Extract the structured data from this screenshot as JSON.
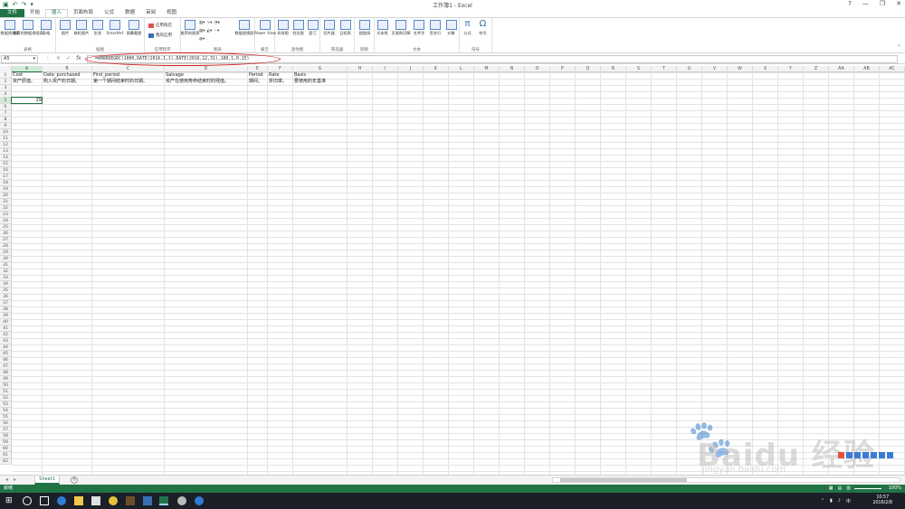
{
  "window": {
    "title": "工作簿1 - Excel",
    "controls": [
      "?",
      "—",
      "❐",
      "✕"
    ]
  },
  "qat": {
    "save_icon": "save-icon",
    "undo_icon": "undo-icon",
    "redo_icon": "redo-icon"
  },
  "tabs": [
    "文件",
    "开始",
    "插入",
    "页面布局",
    "公式",
    "数据",
    "审阅",
    "视图"
  ],
  "ribbon": {
    "groups": [
      {
        "name": "表格",
        "buttons": [
          "数据透视表",
          "推荐的数据透视表",
          "表格"
        ]
      },
      {
        "name": "插图",
        "buttons": [
          "图片",
          "联机图片",
          "形状",
          "SmartArt",
          "屏幕截图"
        ]
      },
      {
        "name": "应用程序",
        "buttons": [
          "应用商店",
          "我的应用"
        ]
      },
      {
        "name": "图表",
        "buttons": [
          "推荐的图表",
          "数据透视图"
        ]
      },
      {
        "name": "报告",
        "buttons": [
          "Power View"
        ]
      },
      {
        "name": "迷你图",
        "buttons": [
          "折线图",
          "柱形图",
          "盈亏"
        ]
      },
      {
        "name": "筛选器",
        "buttons": [
          "切片器",
          "日程表"
        ]
      },
      {
        "name": "链接",
        "buttons": [
          "超链接"
        ]
      },
      {
        "name": "文本",
        "buttons": [
          "文本框",
          "页眉和页脚",
          "艺术字",
          "签名行",
          "对象"
        ]
      },
      {
        "name": "符号",
        "buttons": [
          "公式",
          "符号"
        ]
      }
    ]
  },
  "formula_bar": {
    "name_box": "A5",
    "formula": "=AMORDEGRC(1000,DATE(2016,1,1),DATE(2016,12,31),100,1,0.15)"
  },
  "columns": [
    "A",
    "B",
    "C",
    "D",
    "E",
    "F",
    "G",
    "H",
    "I",
    "J",
    "K",
    "L",
    "M",
    "N",
    "O",
    "P",
    "Q",
    "R",
    "S",
    "T",
    "U",
    "V",
    "W",
    "X",
    "Y",
    "Z",
    "AA",
    "AB",
    "AC"
  ],
  "rows_count": 62,
  "cells": [
    {
      "ref": "A1",
      "value": "Cost"
    },
    {
      "ref": "B1",
      "value": "Date_purchased"
    },
    {
      "ref": "C1",
      "value": "First_period"
    },
    {
      "ref": "D1",
      "value": "Salvage"
    },
    {
      "ref": "E1",
      "value": "Period"
    },
    {
      "ref": "F1",
      "value": "Rate"
    },
    {
      "ref": "G1",
      "value": "Basis"
    },
    {
      "ref": "A2",
      "value": "资产原值。"
    },
    {
      "ref": "B2",
      "value": "购入资产的日期。"
    },
    {
      "ref": "C2",
      "value": "第一个期间结束时的日期。"
    },
    {
      "ref": "D2",
      "value": "资产在使用寿命结束时的残值。"
    },
    {
      "ref": "E2",
      "value": "期间。"
    },
    {
      "ref": "F2",
      "value": "折旧率。"
    },
    {
      "ref": "G2",
      "value": "要使用的年基准"
    },
    {
      "ref": "A5",
      "value": "29",
      "numeric": true
    }
  ],
  "sheets": [
    "Sheet1"
  ],
  "status": {
    "ready": "就绪",
    "zoom": "100%"
  },
  "taskbar": {
    "time": "10:57",
    "date": "2016/2/8"
  },
  "watermark": {
    "brand": "Baidu 经验",
    "url": "jingyan.baidu.com"
  },
  "colors": {
    "excel_green": "#217346",
    "highlight_oval": "#d21a1a"
  }
}
